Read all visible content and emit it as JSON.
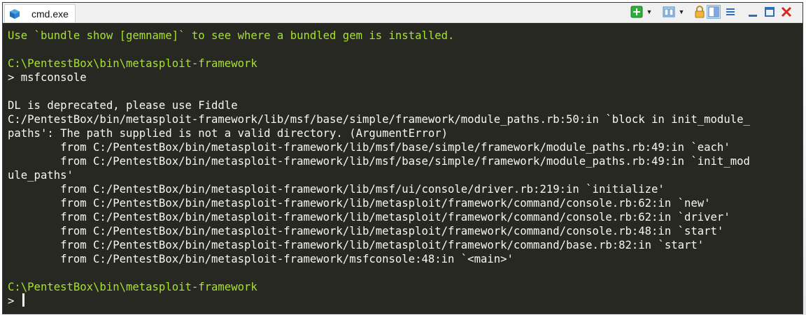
{
  "window": {
    "tab_title": "cmd.exe",
    "tab_icon": "console-window-icon"
  },
  "toolbar": {
    "new_tab_icon": "plus-icon",
    "view_icon": "panes-icon",
    "lock_icon": "lock-icon",
    "split_icon": "split-view-icon",
    "menu_icon": "hamburger-icon",
    "minimize_icon": "minimize-icon",
    "maximize_icon": "maximize-icon",
    "close_icon": "close-icon"
  },
  "colors": {
    "background": "#272822",
    "foreground": "#f8f8f2",
    "prompt": "#a6e22e"
  },
  "terminal": {
    "lines": [
      "Use `bundle show [gemname]` to see where a bundled gem is installed.",
      "",
      "C:\\PentestBox\\bin\\metasploit-framework",
      "> msfconsole",
      "",
      "DL is deprecated, please use Fiddle",
      "C:/PentestBox/bin/metasploit-framework/lib/msf/base/simple/framework/module_paths.rb:50:in `block in init_module_",
      "paths': The path supplied is not a valid directory. (ArgumentError)",
      "        from C:/PentestBox/bin/metasploit-framework/lib/msf/base/simple/framework/module_paths.rb:49:in `each'",
      "        from C:/PentestBox/bin/metasploit-framework/lib/msf/base/simple/framework/module_paths.rb:49:in `init_mod",
      "ule_paths'",
      "        from C:/PentestBox/bin/metasploit-framework/lib/msf/ui/console/driver.rb:219:in `initialize'",
      "        from C:/PentestBox/bin/metasploit-framework/lib/metasploit/framework/command/console.rb:62:in `new'",
      "        from C:/PentestBox/bin/metasploit-framework/lib/metasploit/framework/command/console.rb:62:in `driver'",
      "        from C:/PentestBox/bin/metasploit-framework/lib/metasploit/framework/command/console.rb:48:in `start'",
      "        from C:/PentestBox/bin/metasploit-framework/lib/metasploit/framework/command/base.rb:82:in `start'",
      "        from C:/PentestBox/bin/metasploit-framework/msfconsole:48:in `<main>'",
      "",
      "C:\\PentestBox\\bin\\metasploit-framework",
      ">"
    ]
  }
}
